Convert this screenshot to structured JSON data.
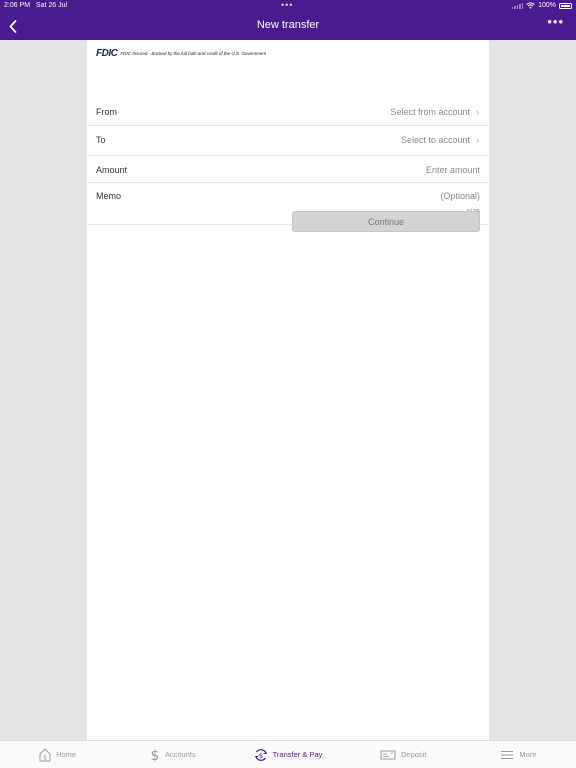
{
  "status_bar": {
    "time": "2:06 PM",
    "date": "Sat 26 Jul",
    "battery": "100%"
  },
  "nav": {
    "title": "New transfer"
  },
  "fdic": {
    "logo": "FDIC",
    "text": "FDIC-Insured - Backed by the full faith and credit of the U.S. Government"
  },
  "form": {
    "from": {
      "label": "From",
      "placeholder": "Select from account"
    },
    "to": {
      "label": "To",
      "placeholder": "Select to account"
    },
    "amount": {
      "label": "Amount",
      "placeholder": "Enter amount"
    },
    "memo": {
      "label": "Memo",
      "placeholder": "(Optional)",
      "counter": "0/75"
    },
    "continue_label": "Continue"
  },
  "tabs": [
    {
      "label": "Home",
      "icon": "home-icon"
    },
    {
      "label": "Accounts",
      "icon": "dollar-icon"
    },
    {
      "label": "Transfer & Pay",
      "icon": "transfer-pay-icon",
      "active": true
    },
    {
      "label": "Deposit",
      "icon": "deposit-check-icon"
    },
    {
      "label": "More",
      "icon": "menu-icon"
    }
  ],
  "colors": {
    "brand": "#4a1a8f",
    "button_disabled": "#d3d3d3",
    "background": "#e4e4e4"
  }
}
